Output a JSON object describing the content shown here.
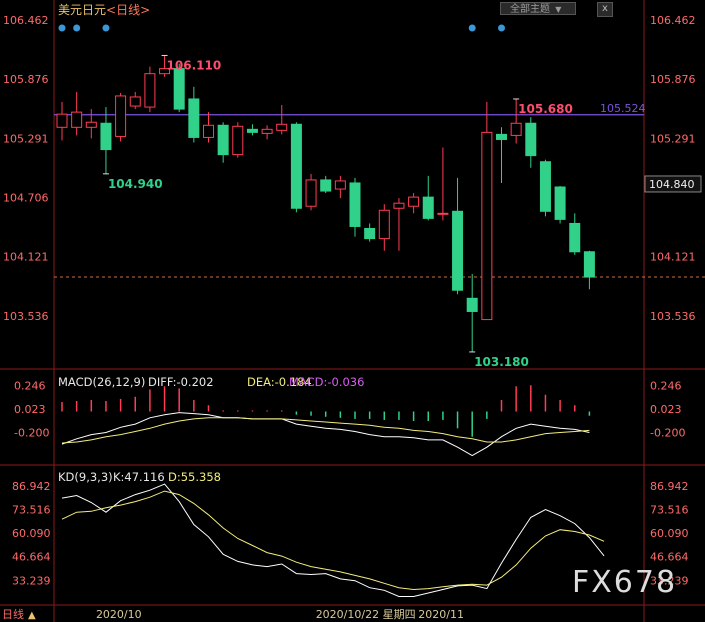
{
  "header": {
    "symbol": "美元日元",
    "period": "<日线>",
    "topic_button": "全部主题",
    "close_button": "x"
  },
  "watermark": "FX678",
  "chart_data": [
    {
      "type": "candlestick",
      "panel": "price",
      "yticks": [
        106.462,
        105.876,
        105.291,
        104.706,
        104.121,
        103.536
      ],
      "ylim": [
        103.13,
        106.5
      ],
      "ytick_labels_right": [
        "106.462",
        "105.876",
        "105.291",
        "",
        "104.121",
        "103.536"
      ],
      "current_price": "104.840",
      "horizontal_line": {
        "value": 105.524,
        "label": "105.524",
        "color": "#7b52e0"
      },
      "dashed_line": {
        "value": 103.92,
        "color": "#d0703a"
      },
      "annotations": [
        {
          "text": "106.110",
          "value": 106.11,
          "index": 7,
          "color": "#ff4d6d"
        },
        {
          "text": "104.940",
          "value": 104.94,
          "index": 3,
          "color": "#31d18a"
        },
        {
          "text": "105.680",
          "value": 105.68,
          "index": 31,
          "color": "#ff4d6d"
        },
        {
          "text": "103.180",
          "value": 103.18,
          "index": 28,
          "color": "#31d18a"
        }
      ],
      "signal_dots": [
        0,
        1,
        3,
        28,
        30
      ],
      "x_labels": [
        {
          "text": "2020/10",
          "index": 3
        },
        {
          "text": "2020/10/22 星期四",
          "index": 18
        },
        {
          "text": "2020/11",
          "index": 25
        }
      ],
      "candles": [
        {
          "o": 105.4,
          "h": 105.65,
          "l": 105.27,
          "c": 105.53
        },
        {
          "o": 105.4,
          "h": 105.75,
          "l": 105.32,
          "c": 105.55
        },
        {
          "o": 105.4,
          "h": 105.58,
          "l": 105.29,
          "c": 105.45
        },
        {
          "o": 105.44,
          "h": 105.6,
          "l": 104.94,
          "c": 105.18
        },
        {
          "o": 105.31,
          "h": 105.74,
          "l": 105.26,
          "c": 105.71
        },
        {
          "o": 105.61,
          "h": 105.75,
          "l": 105.58,
          "c": 105.7
        },
        {
          "o": 105.6,
          "h": 106.0,
          "l": 105.55,
          "c": 105.93
        },
        {
          "o": 105.93,
          "h": 106.11,
          "l": 105.9,
          "c": 105.98
        },
        {
          "o": 105.98,
          "h": 106.03,
          "l": 105.55,
          "c": 105.58
        },
        {
          "o": 105.68,
          "h": 105.8,
          "l": 105.25,
          "c": 105.3
        },
        {
          "o": 105.3,
          "h": 105.55,
          "l": 105.25,
          "c": 105.42
        },
        {
          "o": 105.42,
          "h": 105.45,
          "l": 105.05,
          "c": 105.13
        },
        {
          "o": 105.13,
          "h": 105.45,
          "l": 105.1,
          "c": 105.41
        },
        {
          "o": 105.38,
          "h": 105.43,
          "l": 105.32,
          "c": 105.35
        },
        {
          "o": 105.34,
          "h": 105.42,
          "l": 105.28,
          "c": 105.38
        },
        {
          "o": 105.37,
          "h": 105.62,
          "l": 105.33,
          "c": 105.43
        },
        {
          "o": 105.43,
          "h": 105.45,
          "l": 104.56,
          "c": 104.6
        },
        {
          "o": 104.62,
          "h": 104.94,
          "l": 104.58,
          "c": 104.88
        },
        {
          "o": 104.88,
          "h": 104.92,
          "l": 104.75,
          "c": 104.77
        },
        {
          "o": 104.79,
          "h": 104.92,
          "l": 104.7,
          "c": 104.87
        },
        {
          "o": 104.85,
          "h": 104.9,
          "l": 104.32,
          "c": 104.42
        },
        {
          "o": 104.4,
          "h": 104.45,
          "l": 104.27,
          "c": 104.3
        },
        {
          "o": 104.3,
          "h": 104.64,
          "l": 104.18,
          "c": 104.58
        },
        {
          "o": 104.6,
          "h": 104.7,
          "l": 104.18,
          "c": 104.65
        },
        {
          "o": 104.62,
          "h": 104.75,
          "l": 104.55,
          "c": 104.71
        },
        {
          "o": 104.71,
          "h": 104.92,
          "l": 104.48,
          "c": 104.5
        },
        {
          "o": 104.55,
          "h": 105.2,
          "l": 104.48,
          "c": 104.55
        },
        {
          "o": 104.57,
          "h": 104.9,
          "l": 103.75,
          "c": 103.79
        },
        {
          "o": 103.71,
          "h": 103.95,
          "l": 103.18,
          "c": 103.58
        },
        {
          "o": 103.5,
          "h": 105.65,
          "l": 103.5,
          "c": 105.35
        },
        {
          "o": 105.33,
          "h": 105.4,
          "l": 104.85,
          "c": 105.28
        },
        {
          "o": 105.32,
          "h": 105.68,
          "l": 105.24,
          "c": 105.44
        },
        {
          "o": 105.44,
          "h": 105.5,
          "l": 105.0,
          "c": 105.12
        },
        {
          "o": 105.06,
          "h": 105.08,
          "l": 104.52,
          "c": 104.57
        },
        {
          "o": 104.81,
          "h": 104.82,
          "l": 104.45,
          "c": 104.49
        },
        {
          "o": 104.45,
          "h": 104.55,
          "l": 104.14,
          "c": 104.17
        },
        {
          "o": 104.17,
          "h": 104.18,
          "l": 103.8,
          "c": 103.92
        }
      ]
    },
    {
      "type": "macd",
      "panel": "macd",
      "label": "MACD(26,12,9)",
      "diff_label": "DIFF:-0.202",
      "dea_label": "DEA:-0.184",
      "macd_label": "MACD:-0.036",
      "yticks": [
        "0.246",
        "0.023",
        "-0.200"
      ],
      "ylim": [
        -0.49,
        0.3
      ],
      "diff": [
        -0.31,
        -0.26,
        -0.22,
        -0.2,
        -0.15,
        -0.12,
        -0.06,
        -0.03,
        -0.01,
        -0.02,
        -0.03,
        -0.06,
        -0.06,
        -0.07,
        -0.07,
        -0.07,
        -0.12,
        -0.14,
        -0.16,
        -0.17,
        -0.19,
        -0.22,
        -0.24,
        -0.24,
        -0.25,
        -0.27,
        -0.27,
        -0.34,
        -0.42,
        -0.34,
        -0.24,
        -0.16,
        -0.12,
        -0.14,
        -0.16,
        -0.17,
        -0.2
      ],
      "dea": [
        -0.3,
        -0.29,
        -0.27,
        -0.24,
        -0.22,
        -0.19,
        -0.16,
        -0.12,
        -0.09,
        -0.07,
        -0.06,
        -0.06,
        -0.06,
        -0.07,
        -0.07,
        -0.07,
        -0.08,
        -0.09,
        -0.1,
        -0.11,
        -0.12,
        -0.13,
        -0.15,
        -0.16,
        -0.18,
        -0.19,
        -0.21,
        -0.24,
        -0.26,
        -0.29,
        -0.29,
        -0.27,
        -0.24,
        -0.21,
        -0.2,
        -0.19,
        -0.18
      ],
      "histogram": [
        0.09,
        0.1,
        0.11,
        0.1,
        0.12,
        0.14,
        0.21,
        0.24,
        0.22,
        0.11,
        0.06,
        0.01,
        0.01,
        0.01,
        0.01,
        0.01,
        -0.03,
        -0.04,
        -0.05,
        -0.06,
        -0.07,
        -0.07,
        -0.08,
        -0.08,
        -0.09,
        -0.09,
        -0.08,
        -0.16,
        -0.24,
        -0.07,
        0.11,
        0.24,
        0.25,
        0.16,
        0.11,
        0.06,
        -0.04
      ]
    },
    {
      "type": "kd",
      "panel": "kd",
      "label": "KD(9,3,3)",
      "k_label": "K:47.116",
      "d_label": "D:55.358",
      "yticks_left": [
        "86.942",
        "73.516",
        "60.090",
        "46.664",
        "33.239"
      ],
      "yticks_right": [
        "86.942",
        "73.516",
        "60.090",
        "46.664",
        "33.239"
      ],
      "ylim": [
        22.0,
        96.0
      ],
      "k": [
        80.0,
        81.5,
        77.5,
        72.0,
        78.5,
        82.0,
        84.5,
        88.0,
        78.0,
        65.0,
        58.0,
        48.0,
        44.0,
        42.0,
        41.0,
        42.5,
        37.0,
        36.5,
        37.0,
        34.0,
        33.0,
        29.0,
        27.5,
        24.0,
        24.0,
        26.0,
        28.0,
        30.0,
        30.5,
        28.5,
        43.0,
        56.5,
        69.0,
        73.5,
        70.0,
        65.5,
        57.5,
        47.1
      ],
      "d": [
        68.0,
        72.0,
        72.5,
        74.5,
        76.0,
        78.0,
        80.5,
        84.0,
        82.0,
        77.0,
        70.5,
        63.0,
        57.0,
        53.0,
        49.0,
        47.0,
        43.5,
        41.0,
        39.5,
        38.0,
        36.0,
        34.0,
        31.5,
        29.0,
        28.0,
        28.5,
        29.5,
        30.5,
        31.0,
        30.5,
        35.0,
        42.0,
        51.5,
        58.5,
        62.0,
        61.0,
        59.0,
        55.4
      ]
    }
  ],
  "colors": {
    "up": "#ff3d55",
    "down": "#31d18a",
    "axis_text_left": "#ff6b6b",
    "grid": "#8b1a1a",
    "dot": "#3c97d6",
    "diff_line": "#ffffff",
    "dea_line": "#f3ec7c",
    "k_line": "#ffffff",
    "d_line": "#f3ec7c"
  },
  "footer": {
    "left_text": "日线",
    "arrow": "▲"
  }
}
